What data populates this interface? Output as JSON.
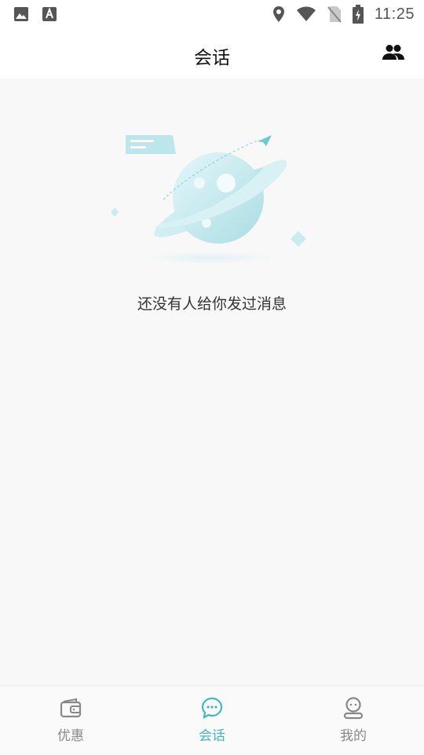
{
  "status_bar": {
    "time": "11:25",
    "icons": [
      "image-icon",
      "font-a-icon",
      "location-icon",
      "wifi-icon",
      "no-sim-icon",
      "battery-charging-icon"
    ]
  },
  "header": {
    "title": "会话",
    "action_icon": "contacts-icon"
  },
  "empty_state": {
    "illustration": "planet-illustration",
    "message": "还没有人给你发过消息"
  },
  "tabbar": {
    "tabs": [
      {
        "label": "优惠",
        "icon": "wallet-icon",
        "active": false
      },
      {
        "label": "会话",
        "icon": "chat-bubble-icon",
        "active": true
      },
      {
        "label": "我的",
        "icon": "profile-icon",
        "active": false
      }
    ]
  },
  "colors": {
    "accent": "#3fb8c4",
    "inactive": "#888888",
    "background": "#f8f8f8",
    "surface": "#ffffff"
  }
}
